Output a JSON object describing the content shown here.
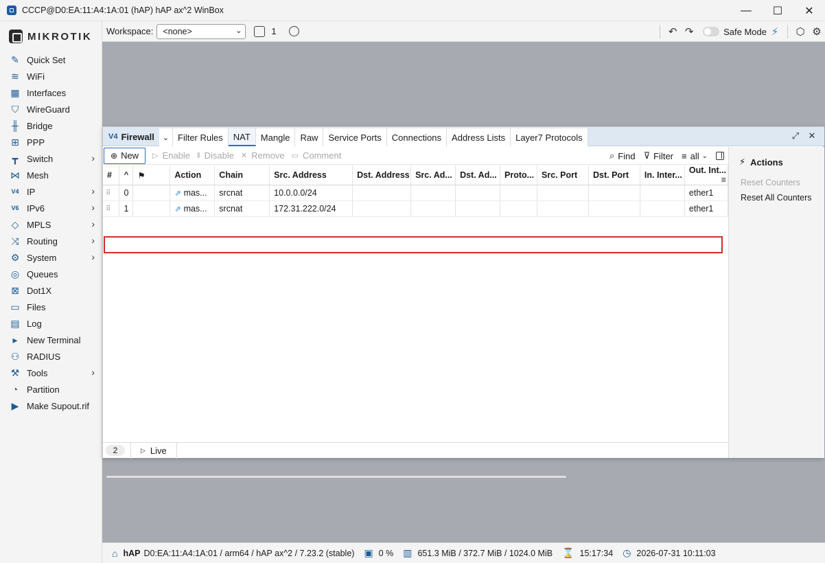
{
  "window": {
    "title": "CCCP@D0:EA:11:A4:1A:01 (hAP) hAP ax^2 WinBox",
    "min_glyph": "—",
    "max_glyph": "☐",
    "close_glyph": "✕"
  },
  "brand": {
    "wordmark": "MIKROTIK"
  },
  "sidebar": {
    "items": [
      {
        "label": "Quick Set",
        "icon": "wand-icon",
        "glyph": "✎",
        "submenu": false
      },
      {
        "label": "WiFi",
        "icon": "wifi-icon",
        "glyph": "≋",
        "submenu": false
      },
      {
        "label": "Interfaces",
        "icon": "interfaces-icon",
        "glyph": "▦",
        "submenu": false
      },
      {
        "label": "WireGuard",
        "icon": "shield-icon",
        "glyph": "⛉",
        "submenu": false
      },
      {
        "label": "Bridge",
        "icon": "bridge-icon",
        "glyph": "╫",
        "submenu": false
      },
      {
        "label": "PPP",
        "icon": "ppp-icon",
        "glyph": "⊞",
        "submenu": false
      },
      {
        "label": "Switch",
        "icon": "switch-icon",
        "glyph": "┳",
        "submenu": true
      },
      {
        "label": "Mesh",
        "icon": "mesh-icon",
        "glyph": "⋈",
        "submenu": false
      },
      {
        "label": "IP",
        "icon": "ipv4-icon",
        "glyph": "V4",
        "submenu": true
      },
      {
        "label": "IPv6",
        "icon": "ipv6-icon",
        "glyph": "V6",
        "submenu": true
      },
      {
        "label": "MPLS",
        "icon": "tag-icon",
        "glyph": "◇",
        "submenu": true
      },
      {
        "label": "Routing",
        "icon": "routing-icon",
        "glyph": "⤨",
        "submenu": true
      },
      {
        "label": "System",
        "icon": "gear-icon",
        "glyph": "⚙",
        "submenu": true
      },
      {
        "label": "Queues",
        "icon": "queues-icon",
        "glyph": "◎",
        "submenu": false
      },
      {
        "label": "Dot1X",
        "icon": "dot1x-icon",
        "glyph": "⊠",
        "submenu": false
      },
      {
        "label": "Files",
        "icon": "folder-icon",
        "glyph": "▭",
        "submenu": false
      },
      {
        "label": "Log",
        "icon": "log-icon",
        "glyph": "▤",
        "submenu": false
      },
      {
        "label": "New Terminal",
        "icon": "terminal-icon",
        "glyph": "▸",
        "submenu": false
      },
      {
        "label": "RADIUS",
        "icon": "radius-icon",
        "glyph": "⚇",
        "submenu": false
      },
      {
        "label": "Tools",
        "icon": "tools-icon",
        "glyph": "⚒",
        "submenu": true
      },
      {
        "label": "Partition",
        "icon": "partition-icon",
        "glyph": "◔",
        "submenu": false
      },
      {
        "label": "Make Supout.rif",
        "icon": "supout-icon",
        "glyph": "▶",
        "submenu": false
      }
    ],
    "submenu_glyph": "›"
  },
  "topbar": {
    "workspace_label": "Workspace:",
    "workspace_value": "<none>",
    "workspace_chevron": "⌄",
    "window_count": "1",
    "undo_glyph": "↶",
    "redo_glyph": "↷",
    "safe_mode_label": "Safe Mode",
    "safe_mode_glyph": "⚡",
    "cube_glyph": "⬡",
    "settings_glyph": "⚙"
  },
  "firewall": {
    "title": "Firewall",
    "title_glyph": "V4",
    "tab_dropdown_glyph": "⌄",
    "tabs": [
      "Filter Rules",
      "NAT",
      "Mangle",
      "Raw",
      "Service Ports",
      "Connections",
      "Address Lists",
      "Layer7 Protocols"
    ],
    "active_tab": "NAT",
    "expand_glyph": "⤢",
    "close_glyph": "✕",
    "toolbar": {
      "new_label": "New",
      "new_glyph": "⊕",
      "enable_label": "Enable",
      "enable_glyph": "▷",
      "disable_label": "Disable",
      "disable_glyph": "‖",
      "remove_label": "Remove",
      "remove_glyph": "✕",
      "comment_label": "Comment",
      "comment_glyph": "▭",
      "find_label": "Find",
      "find_glyph": "⌕",
      "filter_label": "Filter",
      "filter_glyph": "⊽",
      "view_value": "all",
      "view_glyph": "≡",
      "view_chevron": "⌄"
    },
    "columns": [
      "#",
      "^",
      "⚑",
      "Action",
      "Chain",
      "Src. Address",
      "Dst. Address",
      "Src. Ad...",
      "Dst. Ad...",
      "Proto...",
      "Src. Port",
      "Dst. Port",
      "In. Inter...",
      "Out. Int..."
    ],
    "columns_menu_glyph": "≡",
    "row_drag_glyph": "⠿",
    "action_glyph": "⇗",
    "rows": [
      {
        "num": "0",
        "action": "mas...",
        "chain": "srcnat",
        "src_address": "10.0.0.0/24",
        "out_interface": "ether1"
      },
      {
        "num": "1",
        "action": "mas...",
        "chain": "srcnat",
        "src_address": "172.31.222.0/24",
        "out_interface": "ether1"
      }
    ],
    "row_count": "2",
    "live_label": "Live",
    "live_glyph": "▷",
    "actions_panel": {
      "title": "Actions",
      "title_glyph": "⚡",
      "items": [
        {
          "label": "Reset Counters",
          "enabled": false
        },
        {
          "label": "Reset All Counters",
          "enabled": true
        }
      ]
    }
  },
  "statusbar": {
    "board": "hAP",
    "board_glyph": "⌂",
    "details": "D0:EA:11:A4:1A:01 / arm64 / hAP ax^2 / 7.23.2 (stable)",
    "cpu_glyph": "▣",
    "cpu": "0 %",
    "mem_glyph": "▥",
    "memory": "651.3 MiB / 372.7 MiB / 1024.0 MiB",
    "uptime_glyph": "⌛",
    "uptime": "15:17:34",
    "clock_glyph": "◷",
    "datetime": "2026-07-31 10:11:03"
  },
  "colors": {
    "accent": "#2a6fb5",
    "highlight": "#d62b2b",
    "icon": "#1e5c94"
  }
}
